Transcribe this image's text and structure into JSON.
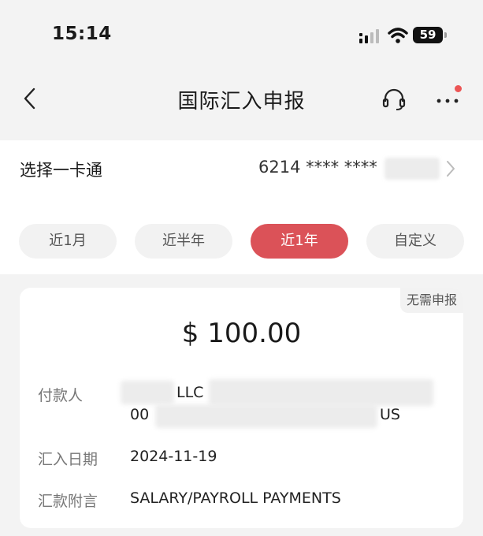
{
  "status_bar": {
    "time": "15:14",
    "battery": "59"
  },
  "nav": {
    "title": "国际汇入申报"
  },
  "card_select": {
    "label": "选择一卡通",
    "card_number": "6214 **** ****"
  },
  "filters": [
    {
      "label": "近1月",
      "active": false
    },
    {
      "label": "近半年",
      "active": false
    },
    {
      "label": "近1年",
      "active": true
    },
    {
      "label": "自定义",
      "active": false
    }
  ],
  "record": {
    "badge": "无需申报",
    "amount": "$ 100.00",
    "payer_label": "付款人",
    "payer_line1": "LLC",
    "payer_line2_start": "00",
    "payer_line2_end": "US",
    "date_label": "汇入日期",
    "date_value": "2024-11-19",
    "memo_label": "汇款附言",
    "memo_value": "SALARY/PAYROLL PAYMENTS"
  },
  "colors": {
    "accent": "#db5258",
    "notification_dot": "#ec5555"
  }
}
